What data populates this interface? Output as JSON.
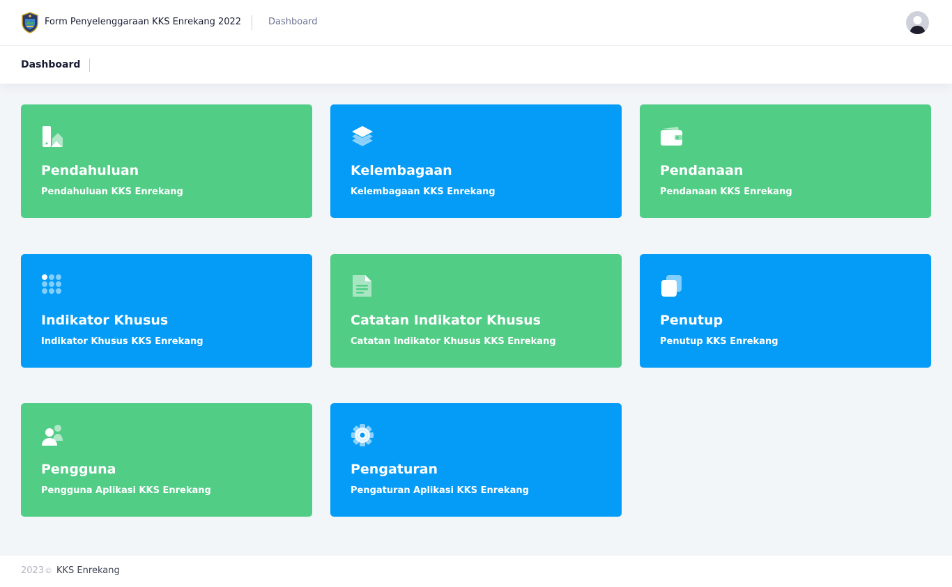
{
  "header": {
    "app_title": "Form Penyelenggaraan KKS Enrekang 2022",
    "breadcrumb": "Dashboard",
    "logo_icon": "regency-crest-icon",
    "avatar_icon": "user-avatar-icon"
  },
  "subheader": {
    "title": "Dashboard"
  },
  "colors": {
    "green": "#51cd86",
    "blue": "#059cf8"
  },
  "tiles": [
    {
      "title": "Pendahuluan",
      "subtitle": "Pendahuluan KKS Enrekang",
      "icon": "document-pen-icon",
      "color": "green"
    },
    {
      "title": "Kelembagaan",
      "subtitle": "Kelembagaan KKS Enrekang",
      "icon": "layers-icon",
      "color": "blue"
    },
    {
      "title": "Pendanaan",
      "subtitle": "Pendanaan KKS Enrekang",
      "icon": "wallet-icon",
      "color": "green"
    },
    {
      "title": "Indikator Khusus",
      "subtitle": "Indikator Khusus KKS Enrekang",
      "icon": "dots-grid-icon",
      "color": "blue"
    },
    {
      "title": "Catatan Indikator Khusus",
      "subtitle": "Catatan Indikator Khusus KKS Enrekang",
      "icon": "file-text-icon",
      "color": "green"
    },
    {
      "title": "Penutup",
      "subtitle": "Penutup KKS Enrekang",
      "icon": "duplicate-icon",
      "color": "blue"
    },
    {
      "title": "Pengguna",
      "subtitle": "Pengguna Aplikasi KKS Enrekang",
      "icon": "users-icon",
      "color": "green"
    },
    {
      "title": "Pengaturan",
      "subtitle": "Pengaturan Aplikasi KKS Enrekang",
      "icon": "gear-icon",
      "color": "blue"
    }
  ],
  "footer": {
    "year": "2023",
    "copyright_symbol": "©",
    "owner": "KKS Enrekang"
  }
}
